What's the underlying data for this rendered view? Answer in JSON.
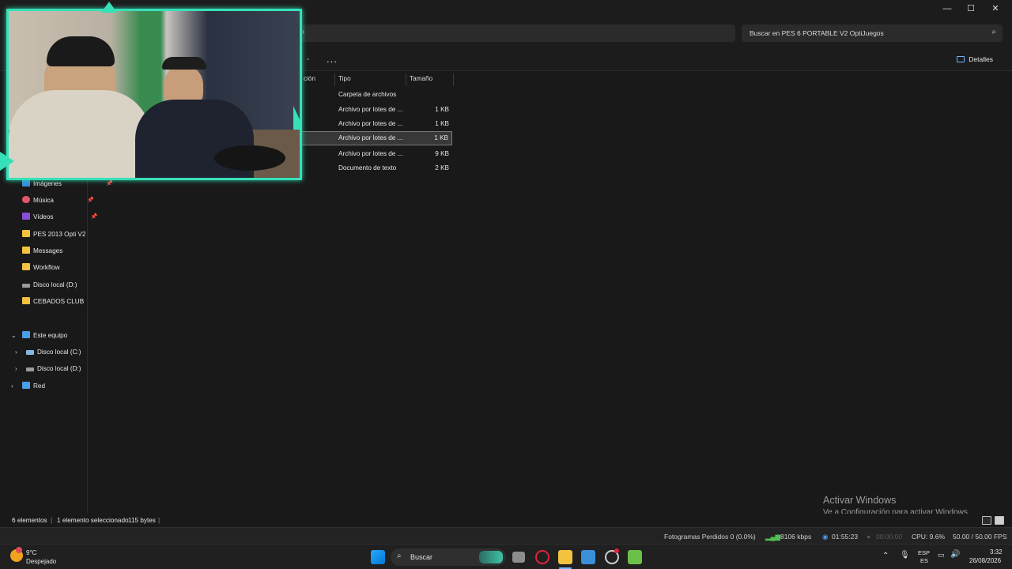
{
  "window": {
    "search_placeholder": "Buscar en PES 6 PORTABLE V2 OptiJuegos",
    "details_label": "Detalles",
    "more_label": "...",
    "minimize": "—",
    "maximize": "☐",
    "close": "✕"
  },
  "columns": {
    "name_fragment": "ción",
    "type": "Tipo",
    "size": "Tamaño"
  },
  "files": [
    {
      "type": "Carpeta de archivos",
      "size": ""
    },
    {
      "type": "Archivo por lotes de ...",
      "size": "1 KB"
    },
    {
      "type": "Archivo por lotes de ...",
      "size": "1 KB"
    },
    {
      "type": "Archivo por lotes de ...",
      "size": "1 KB"
    },
    {
      "type": "Archivo por lotes de ...",
      "size": "9 KB"
    },
    {
      "type": "Documento de texto",
      "size": "2 KB"
    }
  ],
  "sidebar": {
    "quick": [
      {
        "label": "Imágenes"
      },
      {
        "label": "Música"
      },
      {
        "label": "Vídeos"
      },
      {
        "label": "PES 2013 Opti V2"
      },
      {
        "label": "Messages"
      },
      {
        "label": "Workflow"
      },
      {
        "label": "Disco local (D:)"
      },
      {
        "label": "CEBADOS CLUB"
      }
    ],
    "this_pc": "Este equipo",
    "drives": [
      {
        "label": "Disco local (C:)"
      },
      {
        "label": "Disco local (D:)"
      }
    ],
    "network": "Red"
  },
  "status": {
    "count": "6 elementos",
    "selected": "1 elemento seleccionado",
    "bytes": "115 bytes"
  },
  "watermark": {
    "title": "Activar Windows",
    "subtitle": "Ve a Configuración para activar Windows."
  },
  "obs": {
    "dropped": "Fotogramas Perdidos 0 (0.0%)",
    "bitrate": "8106 kbps",
    "live_time": "01:55:23",
    "rec_time": "00:00:00",
    "cpu": "CPU: 9.6%",
    "fps": "50.00 / 50.00 FPS"
  },
  "taskbar": {
    "weather_temp": "9°C",
    "weather_desc": "Despejado",
    "search_label": "Buscar",
    "lang_top": "ESP",
    "lang_bottom": "ES",
    "time": "3:32",
    "date": "26/08/2026"
  }
}
